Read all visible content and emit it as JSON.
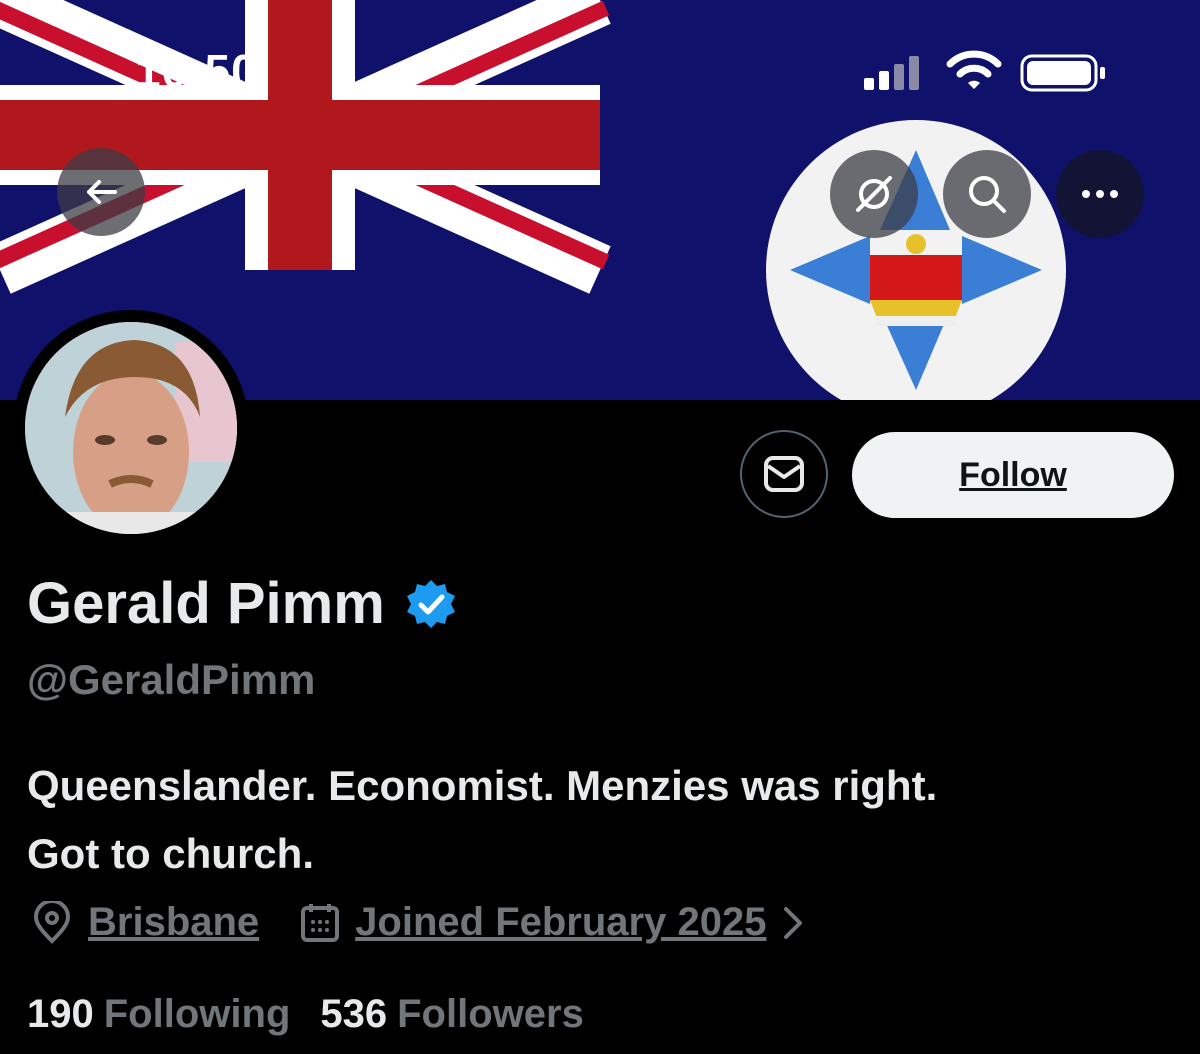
{
  "status_bar": {
    "time": "10:50"
  },
  "header": {
    "back_icon": "arrow-left-icon",
    "grok_icon": "grok-icon",
    "search_icon": "search-icon",
    "more_icon": "more-horizontal-icon"
  },
  "profile": {
    "name": "Gerald Pimm",
    "handle": "@GeraldPimm",
    "bio_line1": "Queenslander. Economist. Menzies was right.",
    "bio_line2": "Got to church.",
    "location": "Brisbane",
    "joined": "Joined February 2025",
    "following_count": "190",
    "following_label": "Following",
    "followers_count": "536",
    "followers_label": "Followers"
  },
  "actions": {
    "follow_label": "Follow",
    "message_icon": "envelope-icon"
  },
  "colors": {
    "banner": "#10116b",
    "verified": "#1d9bf0",
    "muted": "#71767b"
  }
}
